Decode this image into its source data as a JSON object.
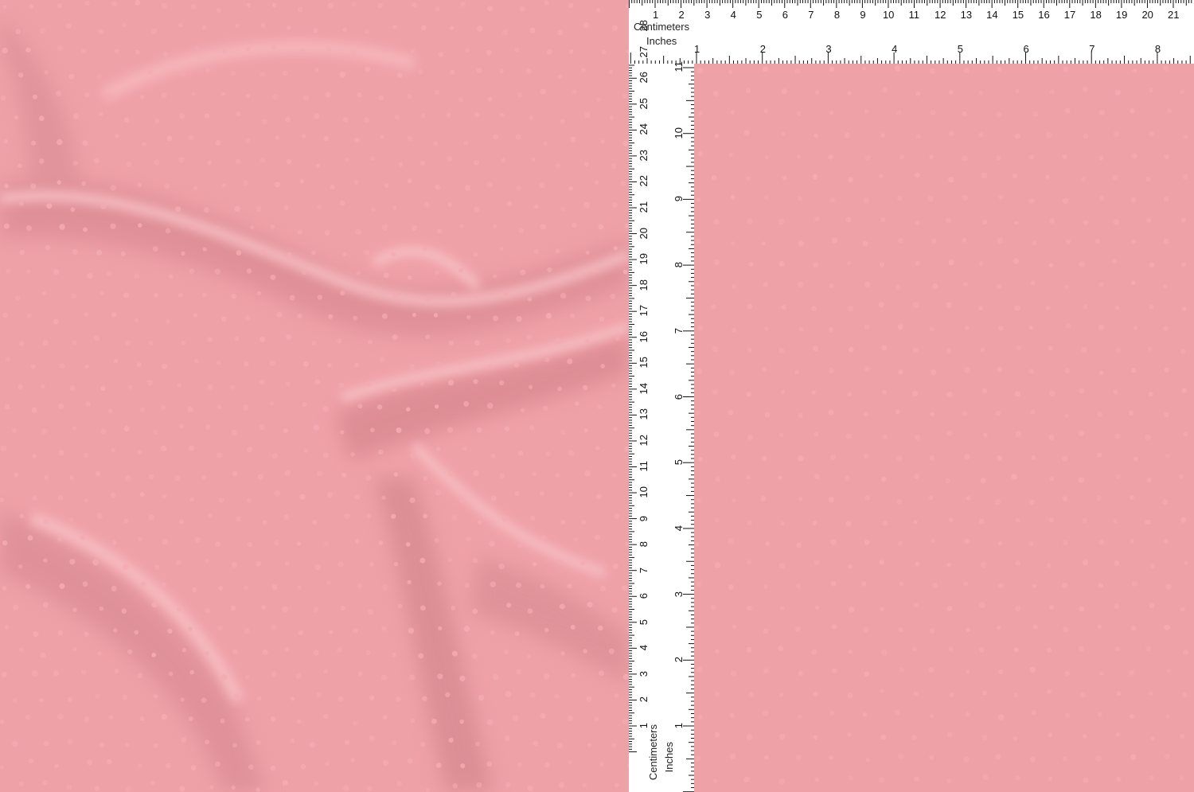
{
  "image": {
    "description": "Pink Swiss dot fabric with rulers",
    "colors": {
      "fabric": "#efa1a8",
      "fabric_shadow": "#df8f96",
      "fabric_highlight": "#f6b8bd",
      "dot": "#f3aab1",
      "ruler_bg": "#ffffff",
      "ruler_ink": "#111111"
    }
  },
  "top_ruler": {
    "centimeters_label": "Centimeters",
    "inches_label": "Inches",
    "cm_ticks": [
      "1",
      "2",
      "3",
      "4",
      "5",
      "6",
      "7",
      "8",
      "9",
      "10",
      "11",
      "12",
      "13",
      "14",
      "15",
      "16",
      "17",
      "18",
      "19",
      "20",
      "21"
    ],
    "inch_ticks": [
      "1",
      "2",
      "3",
      "4",
      "5",
      "6",
      "7",
      "8"
    ]
  },
  "left_ruler": {
    "centimeters_label": "Centimeters",
    "inches_label": "Inches",
    "cm_ticks": [
      "1",
      "2",
      "3",
      "4",
      "5",
      "6",
      "7",
      "8",
      "9",
      "10",
      "11",
      "12",
      "13",
      "14",
      "15",
      "16",
      "17",
      "18",
      "19",
      "20",
      "21",
      "22",
      "23",
      "24",
      "25",
      "26",
      "27",
      "28"
    ],
    "inch_ticks": [
      "1",
      "2",
      "3",
      "4",
      "5",
      "6",
      "7",
      "8",
      "9",
      "10",
      "11"
    ]
  }
}
